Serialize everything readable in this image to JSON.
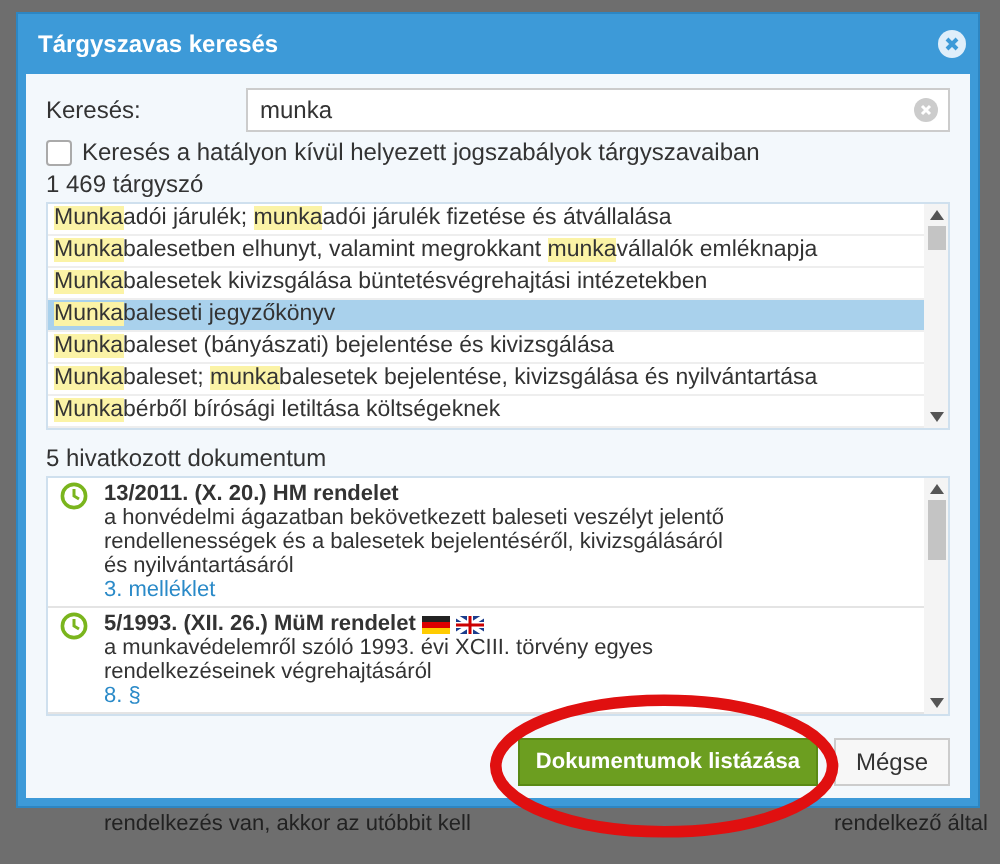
{
  "dialog": {
    "title": "Tárgyszavas keresés"
  },
  "search": {
    "label": "Keresés:",
    "value": "munka"
  },
  "include_repealed": {
    "label": "Keresés a hatályon kívül helyezett jogszabályok tárgyszavaiban",
    "checked": false
  },
  "keyword_count": "1 469 tárgyszó",
  "keywords": [
    {
      "selected": false,
      "segments": [
        {
          "text": "Munka",
          "match": true
        },
        {
          "text": "adói járulék; ",
          "match": false
        },
        {
          "text": "munka",
          "match": true
        },
        {
          "text": "adói járulék fizetése és átvállalása",
          "match": false
        }
      ]
    },
    {
      "selected": false,
      "segments": [
        {
          "text": "Munka",
          "match": true
        },
        {
          "text": "balesetben elhunyt, valamint megrokkant ",
          "match": false
        },
        {
          "text": "munka",
          "match": true
        },
        {
          "text": "vállalók emléknapja",
          "match": false
        }
      ]
    },
    {
      "selected": false,
      "segments": [
        {
          "text": "Munka",
          "match": true
        },
        {
          "text": "balesetek kivizsgálása büntetésvégrehajtási intézetekben",
          "match": false
        }
      ]
    },
    {
      "selected": true,
      "segments": [
        {
          "text": "Munka",
          "match": true
        },
        {
          "text": "baleseti jegyzőkönyv",
          "match": false
        }
      ]
    },
    {
      "selected": false,
      "segments": [
        {
          "text": "Munka",
          "match": true
        },
        {
          "text": "baleset (bányászati) bejelentése és kivizsgálása",
          "match": false
        }
      ]
    },
    {
      "selected": false,
      "segments": [
        {
          "text": "Munka",
          "match": true
        },
        {
          "text": "baleset; ",
          "match": false
        },
        {
          "text": "munka",
          "match": true
        },
        {
          "text": "balesetek bejelentése, kivizsgálása és nyilvántartása",
          "match": false
        }
      ]
    },
    {
      "selected": false,
      "segments": [
        {
          "text": "Munka",
          "match": true
        },
        {
          "text": "bérből bírósági letiltása költségeknek",
          "match": false
        }
      ]
    }
  ],
  "documents_count": "5 hivatkozott dokumentum",
  "documents": [
    {
      "title": "13/2011. (X. 20.) HM rendelet",
      "description": "a honvédelmi ágazatban bekövetkezett baleseti veszélyt jelentő rendellenességek és a balesetek bejelentéséről, kivizsgálásáról és nyilvántartásáról",
      "link": "3. melléklet"
    },
    {
      "title": "5/1993. (XII. 26.) MüM rendelet",
      "translations": [
        {
          "kind": "de"
        },
        {
          "kind": "en"
        }
      ],
      "description": "a munkavédelemről szóló 1993. évi XCIII. törvény egyes rendelkezéseinek végrehajtásáról",
      "link": "8. §"
    }
  ],
  "buttons": {
    "primary": "Dokumentumok listázása",
    "cancel": "Mégse"
  },
  "background_text": {
    "left": "rendelkezés van, akkor az utóbbit kell",
    "right": "rendelkező által"
  }
}
